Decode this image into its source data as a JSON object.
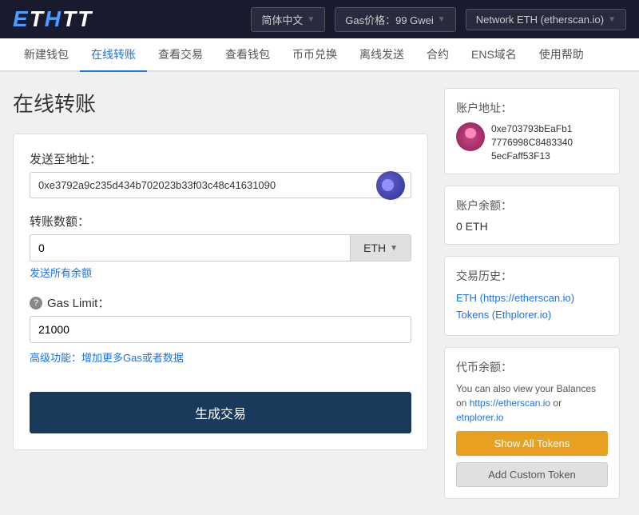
{
  "header": {
    "logo": "ETHTT",
    "language_btn": "简体中文",
    "gas_btn": "Gas价格：99 Gwei",
    "network_btn": "Network ETH (etherscan.io)"
  },
  "nav": {
    "items": [
      {
        "id": "new-wallet",
        "label": "新建钱包",
        "active": false
      },
      {
        "id": "online-transfer",
        "label": "在线转账",
        "active": true
      },
      {
        "id": "view-tx",
        "label": "查看交易",
        "active": false
      },
      {
        "id": "view-wallet",
        "label": "查看钱包",
        "active": false
      },
      {
        "id": "token-exchange",
        "label": "币币兑换",
        "active": false
      },
      {
        "id": "offline-send",
        "label": "离线发送",
        "active": false
      },
      {
        "id": "contract",
        "label": "合约",
        "active": false
      },
      {
        "id": "ens",
        "label": "ENS域名",
        "active": false
      },
      {
        "id": "help",
        "label": "使用帮助",
        "active": false
      }
    ]
  },
  "main": {
    "title": "在线转账",
    "form": {
      "to_address_label": "发送至地址：",
      "to_address_value": "0xe3792a9c235d434b702023b33f03c48c41631090",
      "amount_label": "转账数额：",
      "amount_value": "0",
      "currency_label": "ETH",
      "send_all_label": "发送所有余额",
      "gas_limit_label": "Gas Limit：",
      "gas_limit_value": "21000",
      "advanced_label": "高级功能：增加更多Gas或者数据",
      "generate_btn_label": "生成交易"
    }
  },
  "sidebar": {
    "account_address_title": "账户地址：",
    "account_address": "0xe703793bEaFb17776998C8483340 5ecFaff53F13",
    "balance_title": "账户余额：",
    "balance_value": "0 ETH",
    "history_title": "交易历史：",
    "history_links": [
      {
        "label": "ETH (https://etherscan.io)"
      },
      {
        "label": "Tokens (Ethplorer.io)"
      }
    ],
    "token_title": "代币余额：",
    "token_desc_part1": "You can also view your Balances on ",
    "token_link1": "https://etherscan.io",
    "token_desc_part2": " or ",
    "token_link2": "etnplorer.io",
    "show_all_btn": "Show All Tokens",
    "add_custom_btn": "Add Custom Token"
  }
}
